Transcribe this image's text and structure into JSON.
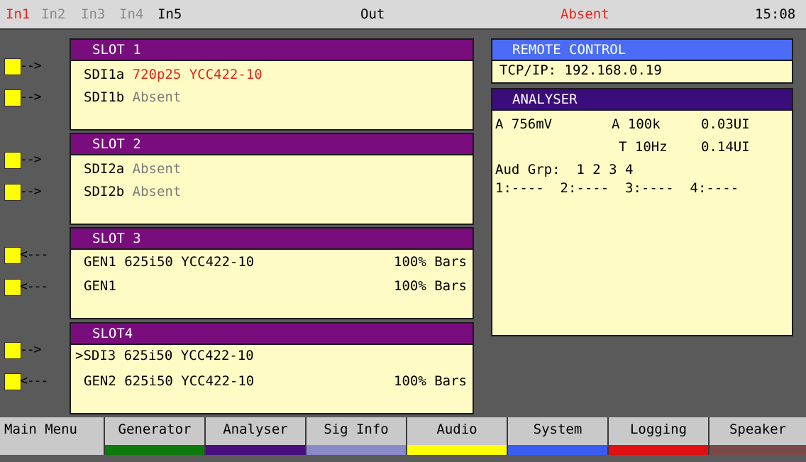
{
  "topbar": {
    "in1": "In1",
    "in2": "In2",
    "in3": "In3",
    "in4": "In4",
    "in5": "In5",
    "out": "Out",
    "status": "Absent",
    "time": "15:08"
  },
  "slots": [
    {
      "title": "SLOT 1",
      "rows": [
        {
          "label": "SDI1a",
          "value": "720p25 YCC422-10",
          "right": ""
        },
        {
          "label": "SDI1b",
          "value": "Absent",
          "right": ""
        }
      ]
    },
    {
      "title": "SLOT 2",
      "rows": [
        {
          "label": "SDI2a",
          "value": "Absent",
          "right": ""
        },
        {
          "label": "SDI2b",
          "value": "Absent",
          "right": ""
        }
      ]
    },
    {
      "title": "SLOT 3",
      "rows": [
        {
          "label": "GEN1",
          "value": "625i50 YCC422-10",
          "right": "100% Bars"
        },
        {
          "label": "GEN1",
          "value": "",
          "right": "100% Bars"
        }
      ]
    },
    {
      "title": "SLOT4",
      "rows": [
        {
          "label": ">SDI3",
          "value": "625i50 YCC422-10",
          "right": ""
        },
        {
          "label": "GEN2",
          "value": "625i50 YCC422-10",
          "right": "100% Bars"
        }
      ]
    }
  ],
  "connectors": {
    "input_arrow": "-->",
    "output_arrow": "<---"
  },
  "remote_control": {
    "title": "REMOTE CONTROL",
    "address": "TCP/IP: 192.168.0.19"
  },
  "analyser": {
    "title": "ANALYSER",
    "level": "A 756mV",
    "a_freq": "A 100k",
    "a_jitter": "0.03UI",
    "t_freq": "T 10Hz",
    "t_jitter": "0.14UI",
    "aud_grp": "Aud Grp:  1 2 3 4",
    "aud_status": "1:----  2:----  3:----  4:----"
  },
  "menu": {
    "main": "Main Menu",
    "tabs": [
      {
        "label": "Generator",
        "color": "#0c7a0c"
      },
      {
        "label": "Analyser",
        "color": "#4a0d80"
      },
      {
        "label": "Sig Info",
        "color": "#8a8ac9"
      },
      {
        "label": "Audio",
        "color": "#ffff00"
      },
      {
        "label": "System",
        "color": "#3a5cf0"
      },
      {
        "label": "Logging",
        "color": "#e01010"
      },
      {
        "label": "Speaker",
        "color": "#7a4a4a"
      }
    ]
  },
  "colors": {
    "panel_bg": "#fffbc4",
    "slot_header": "#7a0d7d",
    "alert": "#e8231a"
  }
}
